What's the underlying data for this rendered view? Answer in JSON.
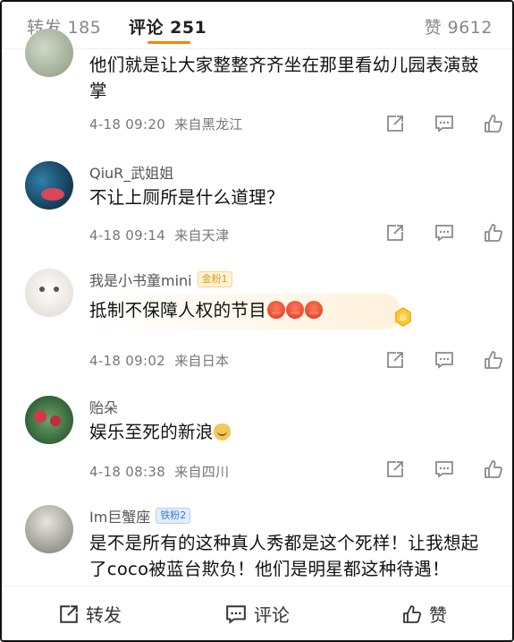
{
  "tabs": {
    "repost": "转发 185",
    "comments": "评论 251",
    "likes": "赞 9612"
  },
  "comments": [
    {
      "text": "他们就是让大家整整齐齐坐在那里看幼儿园表演鼓掌",
      "time": "4-18 09:20",
      "location": "来自黑龙江"
    },
    {
      "user": "QiuR_武姐姐",
      "text": "不让上厕所是什么道理？",
      "time": "4-18 09:14",
      "location": "来自天津"
    },
    {
      "user": "我是小书童mini",
      "badge": "金粉1",
      "text": "抵制不保障人权的节目",
      "emoji": "angry",
      "time": "4-18 09:02",
      "location": "来自日本"
    },
    {
      "user": "贻朵",
      "text": "娱乐至死的新浪",
      "emoji": "doge",
      "time": "4-18 08:38",
      "location": "来自四川"
    },
    {
      "user": "Im巨蟹座",
      "badge": "铁粉2",
      "text": "是不是所有的这种真人秀都是这个死样！让我想起了coco被蓝台欺负！他们是明星都这种待遇！"
    }
  ],
  "bottombar": {
    "repost": "转发",
    "comment": "评论",
    "like": "赞"
  },
  "colors": {
    "accent": "#ff8200",
    "icon": "#8a8a8a"
  }
}
